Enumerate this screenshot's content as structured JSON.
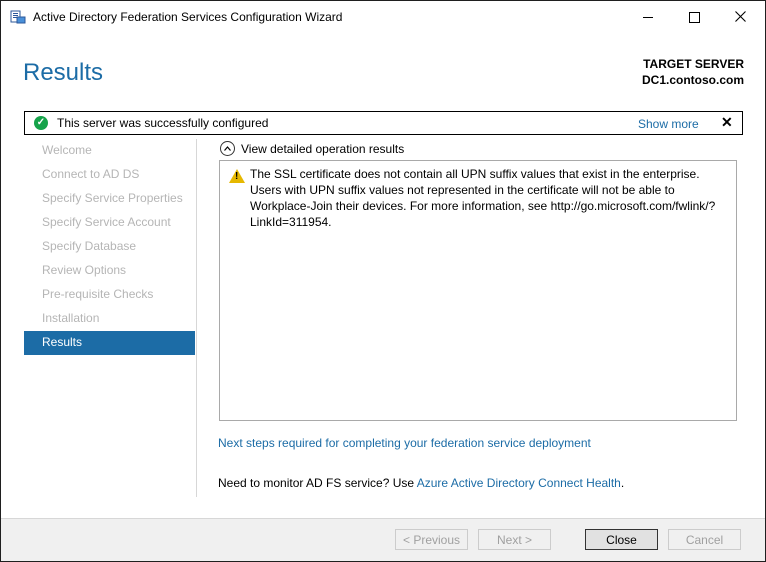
{
  "window": {
    "title": "Active Directory Federation Services Configuration Wizard",
    "app_icon": "server-manager-icon"
  },
  "header": {
    "page_title": "Results",
    "target_label": "TARGET SERVER",
    "target_value": "DC1.contoso.com"
  },
  "status": {
    "icon": "success-check-icon",
    "message": "This server was successfully configured",
    "show_more": "Show more",
    "close_glyph": "✕"
  },
  "nav": {
    "items": [
      {
        "label": "Welcome",
        "active": false
      },
      {
        "label": "Connect to AD DS",
        "active": false
      },
      {
        "label": "Specify Service Properties",
        "active": false
      },
      {
        "label": "Specify Service Account",
        "active": false
      },
      {
        "label": "Specify Database",
        "active": false
      },
      {
        "label": "Review Options",
        "active": false
      },
      {
        "label": "Pre-requisite Checks",
        "active": false
      },
      {
        "label": "Installation",
        "active": false
      },
      {
        "label": "Results",
        "active": true
      }
    ]
  },
  "details": {
    "toggle_label": "View detailed operation results",
    "warning_text": "The SSL certificate does not contain all UPN suffix values that exist in the enterprise.  Users with UPN suffix values not represented in the certificate will not be able to Workplace-Join their devices.  For more information, see http://go.microsoft.com/fwlink/?LinkId=311954."
  },
  "links": {
    "next_steps": "Next steps required for completing your federation service deployment",
    "monitor_prefix": "Need to monitor AD FS service? Use ",
    "monitor_link": "Azure Active Directory Connect Health",
    "monitor_suffix": "."
  },
  "footer": {
    "previous": "< Previous",
    "next": "Next >",
    "close": "Close",
    "cancel": "Cancel"
  },
  "colors": {
    "accent": "#1c6ca6",
    "success": "#16a34a",
    "warning": "#e6b800"
  }
}
